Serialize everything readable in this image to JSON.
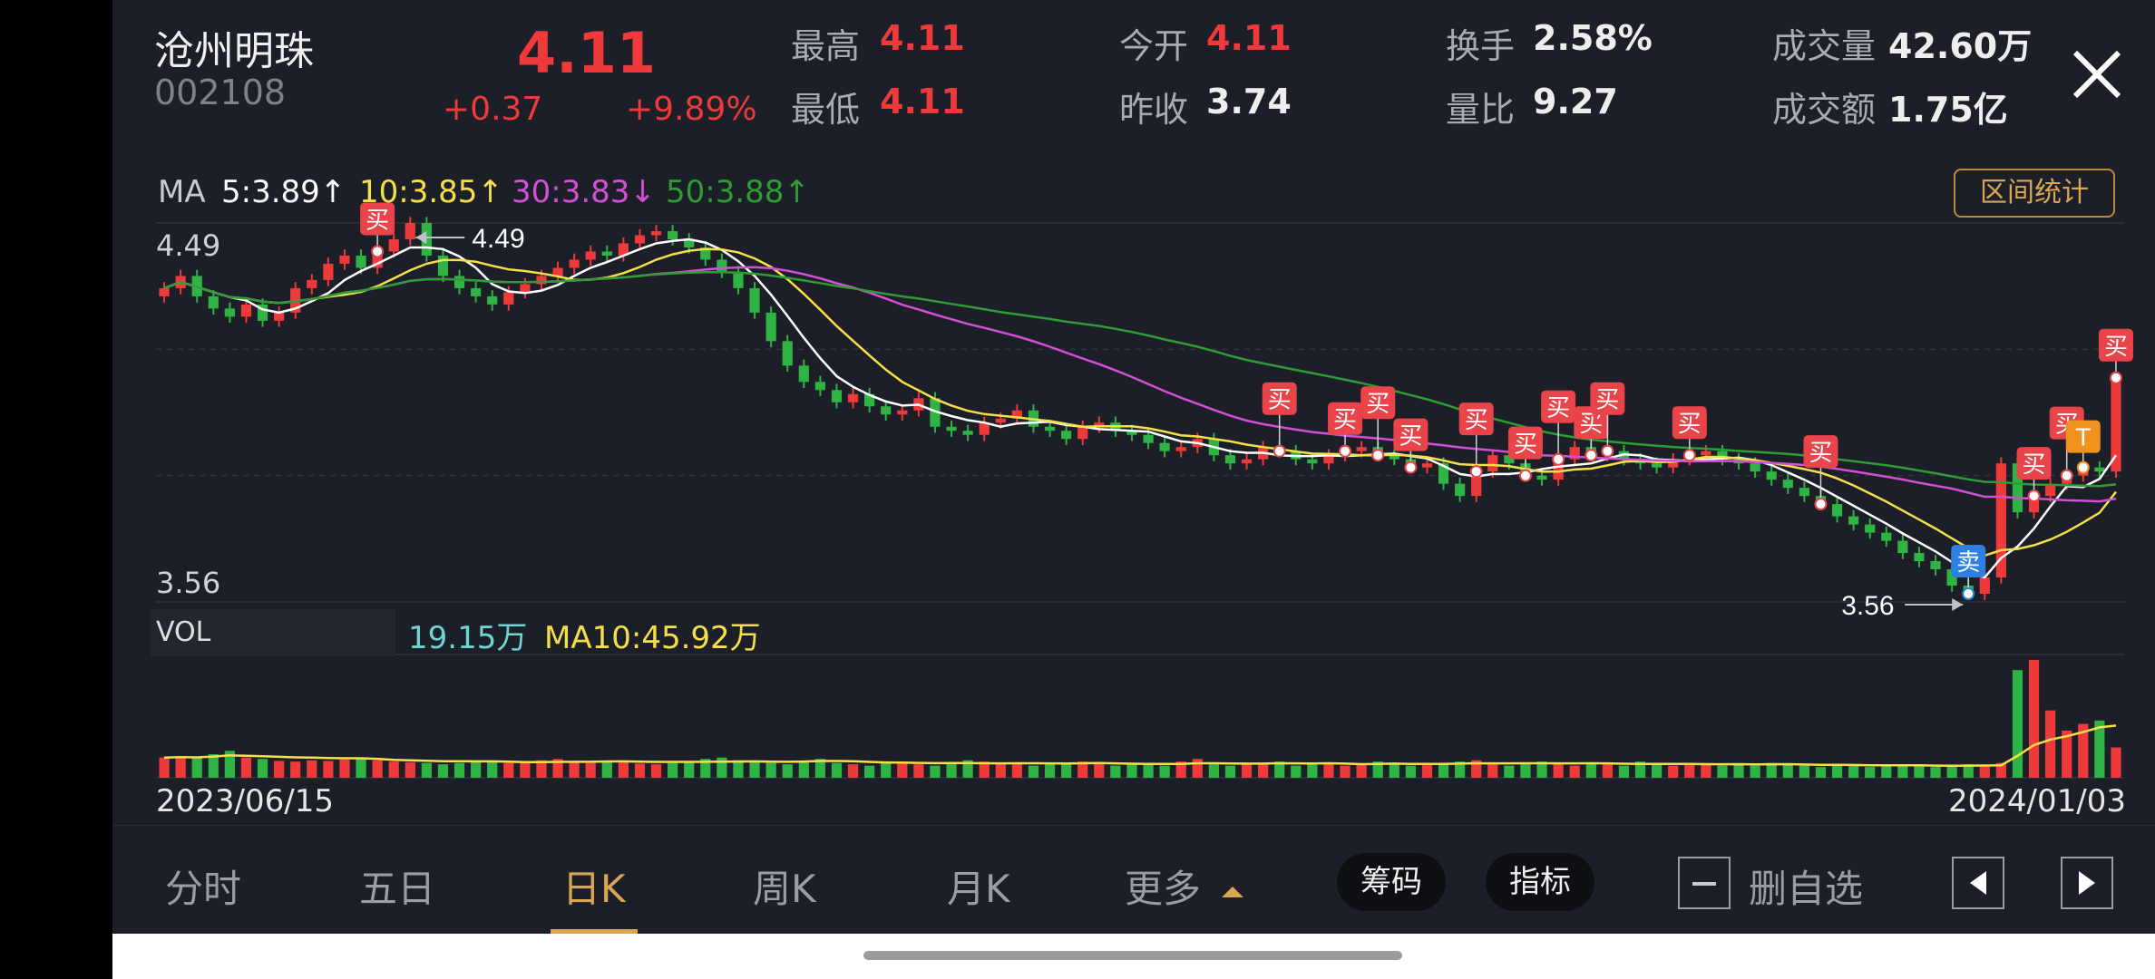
{
  "stock": {
    "name": "沧州明珠",
    "code": "002108",
    "price": "4.11",
    "change": "+0.37",
    "change_pct": "+9.89%"
  },
  "quotes": {
    "high_label": "最高",
    "high": "4.11",
    "low_label": "最低",
    "low": "4.11",
    "open_label": "今开",
    "open": "4.11",
    "prev_close_label": "昨收",
    "prev_close": "3.74",
    "turnover_label": "换手",
    "turnover": "2.58%",
    "vol_ratio_label": "量比",
    "vol_ratio": "9.27",
    "volume_label": "成交量",
    "volume": "42.60万",
    "amount_label": "成交额",
    "amount": "1.75亿"
  },
  "ma_legend": {
    "label": "MA",
    "ma5": "5:3.89",
    "ma10": "10:3.85",
    "ma30": "30:3.83",
    "ma50": "50:3.88",
    "arrow_up": "↑",
    "arrow_down": "↓"
  },
  "range_stats_button": "区间统计",
  "price_axis": {
    "top": "4.49",
    "bottom": "3.56",
    "high_mark": "4.49",
    "low_mark": "3.56"
  },
  "signals": {
    "buy": "买",
    "sell": "卖",
    "t": "T"
  },
  "volume_panel": {
    "label": "VOL",
    "value": "19.15万",
    "ma10": "MA10:45.92万"
  },
  "date_range": {
    "start": "2023/06/15",
    "end": "2024/01/03"
  },
  "tabs": [
    "分时",
    "五日",
    "日K",
    "周K",
    "月K",
    "更多"
  ],
  "buttons": {
    "chips": "筹码",
    "indicators": "指标",
    "remove_watchlist": "删自选"
  },
  "colors": {
    "up": "#ee3a3a",
    "down": "#2fb344",
    "ma5": "#ffffff",
    "ma10": "#f5e04a",
    "ma30": "#d24fd6",
    "ma50": "#2e9d34",
    "accent": "#d9a653"
  },
  "chart_data": {
    "type": "candlestick",
    "period": "daily",
    "y_range": [
      3.56,
      4.49
    ],
    "ma_latest": {
      "MA5": 3.89,
      "MA10": 3.85,
      "MA30": 3.83,
      "MA50": 3.88
    },
    "closes": [
      4.33,
      4.36,
      4.31,
      4.28,
      4.26,
      4.29,
      4.25,
      4.27,
      4.33,
      4.35,
      4.39,
      4.41,
      4.38,
      4.42,
      4.45,
      4.49,
      4.41,
      4.36,
      4.33,
      4.31,
      4.29,
      4.32,
      4.34,
      4.36,
      4.38,
      4.4,
      4.42,
      4.41,
      4.44,
      4.46,
      4.47,
      4.45,
      4.43,
      4.4,
      4.37,
      4.33,
      4.27,
      4.2,
      4.14,
      4.1,
      4.08,
      4.05,
      4.07,
      4.04,
      4.02,
      4.03,
      4.06,
      3.99,
      3.98,
      3.97,
      4.0,
      4.01,
      4.03,
      3.99,
      3.98,
      3.96,
      3.99,
      4.0,
      3.98,
      3.97,
      3.95,
      3.93,
      3.94,
      3.96,
      3.92,
      3.9,
      3.91,
      3.94,
      3.93,
      3.91,
      3.9,
      3.92,
      3.93,
      3.94,
      3.92,
      3.91,
      3.89,
      3.9,
      3.85,
      3.82,
      3.88,
      3.92,
      3.9,
      3.87,
      3.86,
      3.91,
      3.94,
      3.92,
      3.93,
      3.91,
      3.9,
      3.89,
      3.91,
      3.92,
      3.93,
      3.91,
      3.9,
      3.88,
      3.86,
      3.84,
      3.82,
      3.8,
      3.77,
      3.75,
      3.73,
      3.71,
      3.68,
      3.66,
      3.64,
      3.6,
      3.58,
      3.62,
      3.9,
      3.78,
      3.82,
      3.85,
      3.87,
      3.89,
      3.88,
      4.11
    ],
    "volumes": [
      30,
      31,
      30,
      35,
      40,
      30,
      28,
      25,
      24,
      26,
      25,
      27,
      30,
      26,
      24,
      23,
      22,
      20,
      22,
      24,
      25,
      22,
      24,
      26,
      28,
      24,
      22,
      25,
      23,
      21,
      20,
      22,
      24,
      28,
      30,
      26,
      24,
      22,
      20,
      25,
      28,
      22,
      20,
      18,
      22,
      24,
      20,
      18,
      22,
      26,
      24,
      20,
      22,
      18,
      20,
      22,
      24,
      20,
      18,
      20,
      22,
      18,
      24,
      28,
      20,
      18,
      22,
      20,
      24,
      18,
      20,
      22,
      18,
      20,
      24,
      22,
      18,
      20,
      22,
      24,
      26,
      20,
      18,
      22,
      24,
      20,
      18,
      22,
      20,
      18,
      24,
      20,
      18,
      22,
      20,
      18,
      20,
      18,
      22,
      20,
      18,
      16,
      18,
      20,
      16,
      18,
      20,
      18,
      16,
      18,
      20,
      18,
      22,
      160,
      175,
      100,
      70,
      80,
      85,
      45
    ]
  }
}
